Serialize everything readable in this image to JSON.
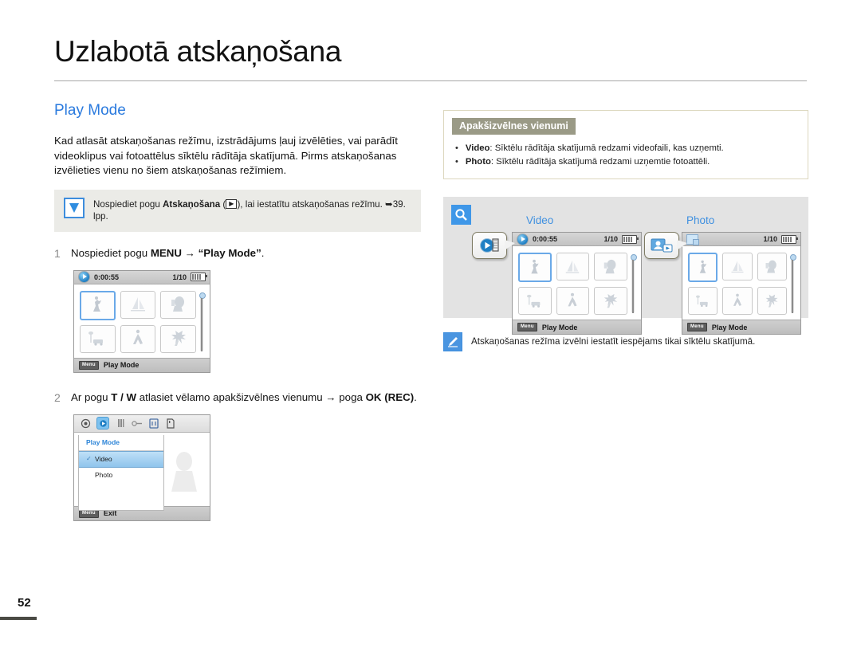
{
  "header": {
    "title": "Uzlabotā atskaņošana",
    "section": "Play Mode"
  },
  "left": {
    "intro": "Kad atlasāt atskaņošanas režīmu, izstrādājums ļauj izvēlēties, vai parādīt videoklipus vai fotoattēlus sīktēlu rādītāja skatījumā. Pirms atskaņošanas izvēlieties vienu no šiem atskaņošanas režīmiem.",
    "note": {
      "icon": "check-box-icon",
      "text_before": "Nospiediet pogu ",
      "bold1": "Atskaņošana",
      "text_mid": " (",
      "play_glyph": "▶",
      "text_after": "), lai iestatītu atskaņošanas režīmu. ➥39. lpp."
    },
    "step1": {
      "num": "1",
      "text_before": "Nospiediet pogu ",
      "bold1": "MENU",
      "arrow": " → ",
      "quoted": "“Play Mode”",
      "text_after": "."
    },
    "step2": {
      "num": "2",
      "text_before": "Ar pogu ",
      "bold1": "T / W",
      "text_mid": " atlasiet vēlamo apakšizvēlnes vienumu → poga ",
      "bold2": "OK (REC)",
      "text_after": "."
    },
    "lcd1": {
      "timecode": "0:00:55",
      "counter": "1/10",
      "footer_key": "Menu",
      "footer_label": "Play Mode",
      "status_icon": "play-mode-icon",
      "battery_icon": "battery-icon"
    },
    "menu_lcd": {
      "header": "Play Mode",
      "items": [
        {
          "label": "Video",
          "selected": true
        },
        {
          "label": "Photo",
          "selected": false
        }
      ],
      "footer_key": "Menu",
      "footer_label": "Exit"
    }
  },
  "right": {
    "submenu_box": {
      "title": "Apakšizvēlnes vienumi",
      "items": [
        {
          "bold": "Video",
          "text": ": Sīktēlu rādītāja skatījumā redzami videofaili, kas uzņemti."
        },
        {
          "bold": "Photo",
          "text": ": Sīktēlu rādītāja skatījumā redzami uzņemtie fotoattēli."
        }
      ]
    },
    "illustration": {
      "magnifier_icon": "magnifier-icon",
      "video": {
        "label": "Video",
        "timecode": "0:00:55",
        "counter": "1/10",
        "footer_key": "Menu",
        "footer_label": "Play Mode",
        "callout_icon": "video-play-callout-icon"
      },
      "photo": {
        "label": "Photo",
        "timecode": "",
        "counter": "1/10",
        "footer_key": "Menu",
        "footer_label": "Play Mode",
        "callout_icon": "photo-play-callout-icon"
      }
    },
    "tip": {
      "icon": "pen-tip-icon",
      "text": "Atskaņošanas režīma izvēlni iestatīt iespējams tikai sīktēlu skatījumā."
    }
  },
  "footer": {
    "page_number": "52"
  },
  "colors": {
    "accent_blue": "#2a7ade",
    "note_bg": "#ebebe7",
    "badge_olive": "#9a9a86",
    "panel_gray": "#e3e3e3"
  }
}
